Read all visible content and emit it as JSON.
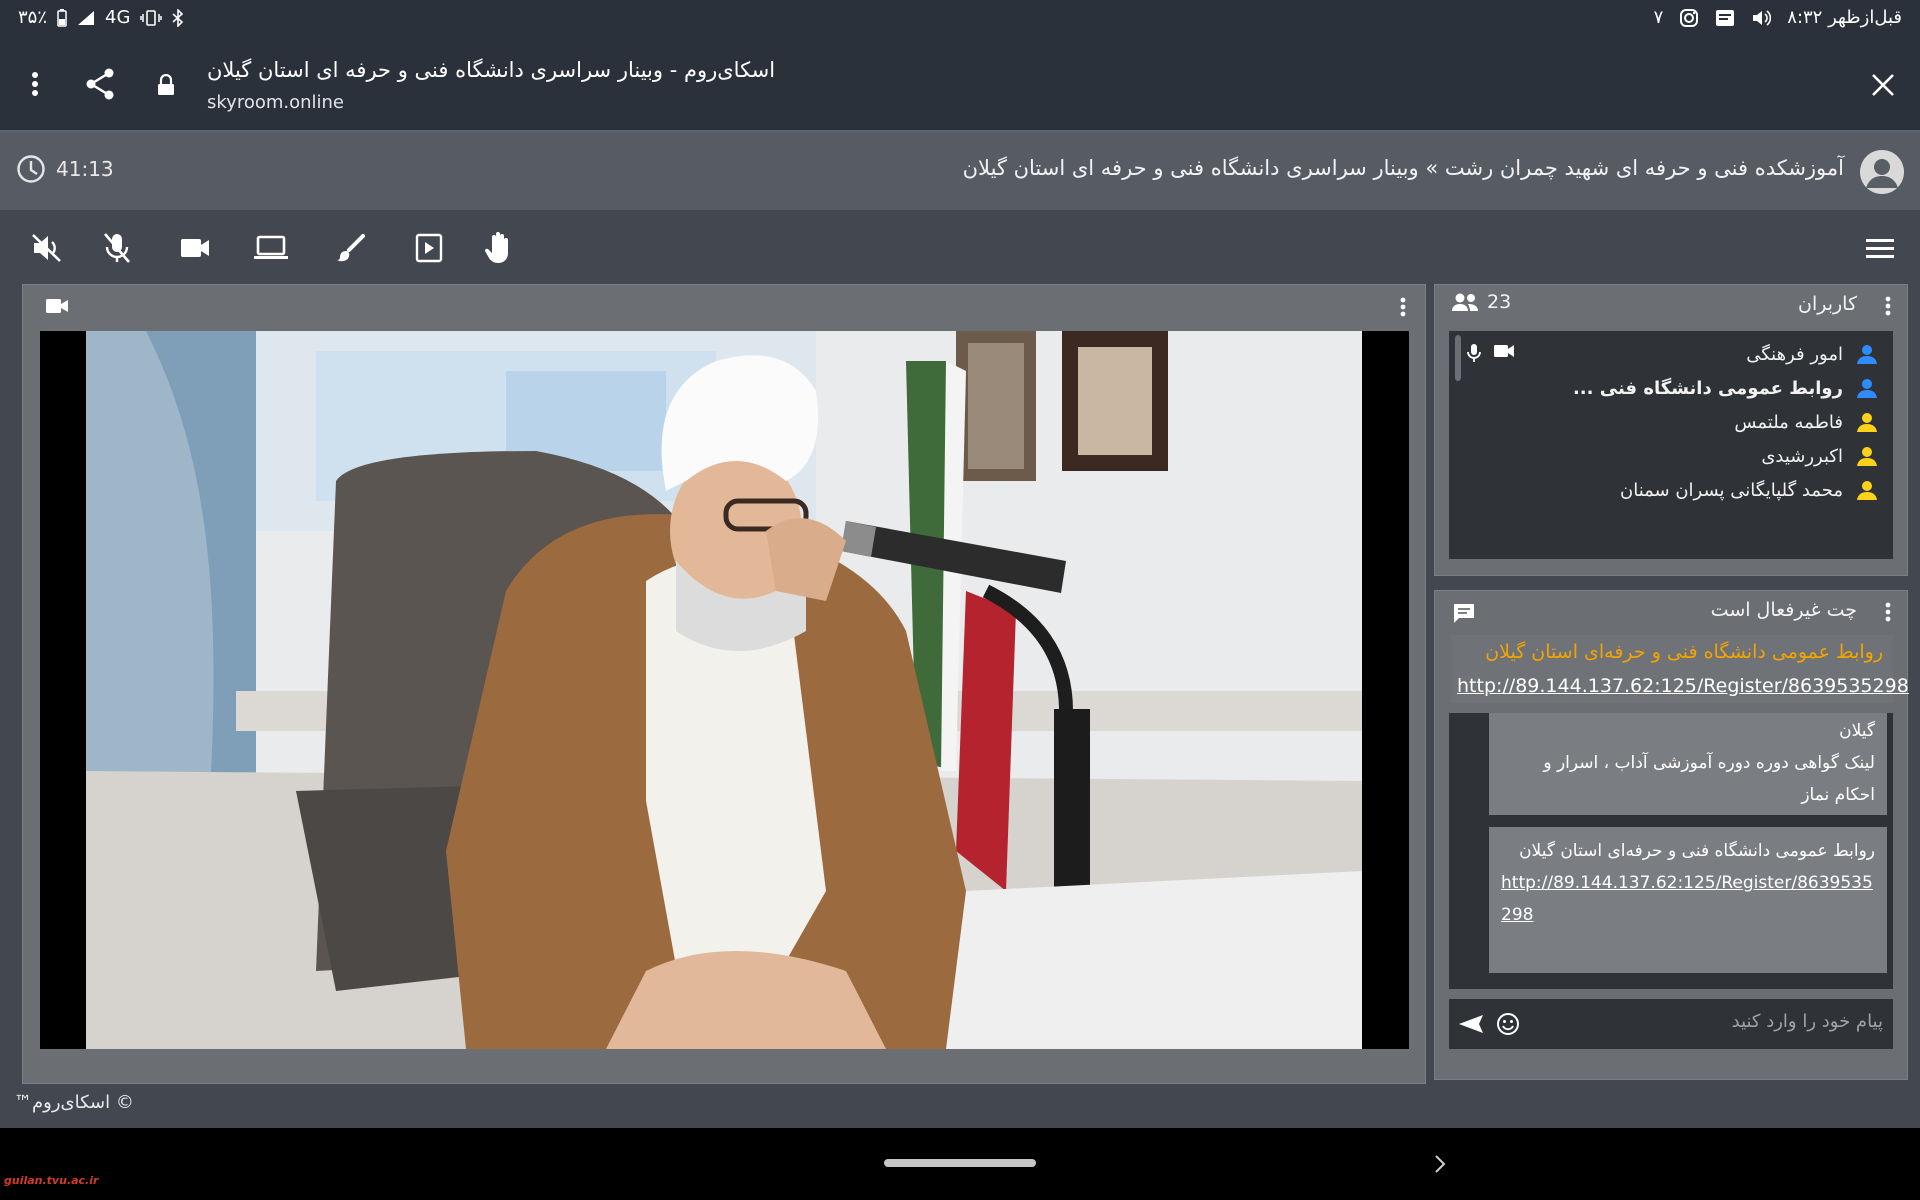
{
  "status_bar": {
    "battery_percent": "۳۵٪",
    "network": "4G",
    "time": "۸:۳۲ قبل‌ازظهر",
    "notification_count": "۷",
    "icons": [
      "battery-icon",
      "signal-icon",
      "vibrate-icon",
      "bluetooth-icon",
      "instagram-icon",
      "message-icon",
      "volume-icon"
    ]
  },
  "browser": {
    "title": "اسکای‌روم - وبینار سراسری دانشگاه فنی و حرفه ای استان گیلان",
    "host": "skyroom.online"
  },
  "header": {
    "timer": "41:13",
    "breadcrumb": "آموزشکده فنی و حرفه ای شهید چمران رشت » وبینار سراسری دانشگاه فنی و حرفه ای استان گیلان"
  },
  "toolbar": {
    "buttons": [
      "speaker-muted-icon",
      "mic-muted-icon",
      "camera-icon",
      "screen-share-icon",
      "whiteboard-brush-icon",
      "media-play-icon",
      "raise-hand-icon"
    ]
  },
  "users_panel": {
    "title": "کاربران",
    "count": "23",
    "users": [
      {
        "name": "امور فرهنگی",
        "bold": false,
        "color": "#2f8cff",
        "media": true
      },
      {
        "name": "روابط عمومی دانشگاه فنی ...",
        "bold": true,
        "color": "#2f8cff",
        "media": false
      },
      {
        "name": "فاطمه ملتمس",
        "bold": false,
        "color": "#ffd21a",
        "media": false
      },
      {
        "name": "اکبررشیدی",
        "bold": false,
        "color": "#ffd21a",
        "media": false
      },
      {
        "name": "محمد گلپایگانی پسران سمنان",
        "bold": false,
        "color": "#ffd21a",
        "media": false
      }
    ]
  },
  "chat_panel": {
    "title": "چت غیرفعال است",
    "pinned": {
      "sender": "روابط عمومی دانشگاه فنی و حرفه‌ای استان گیلان",
      "link": "http://89.144.137.62:125/Register/8639535298"
    },
    "messages": [
      {
        "lines": [
          "گیلان",
          "لینک گواهی دوره دوره آموزشی آداب ، اسرار و احکام نماز"
        ],
        "link": ""
      },
      {
        "lines": [
          "روابط عمومی دانشگاه فنی و حرفه‌ای استان گیلان"
        ],
        "link": "http://89.144.137.62:125/Register/8639535298"
      }
    ],
    "input_placeholder": "پیام خود را وارد کنید"
  },
  "footer": {
    "copyright": "© اسکای‌روم™"
  },
  "watermark": "guilan.tvu.ac.ir"
}
